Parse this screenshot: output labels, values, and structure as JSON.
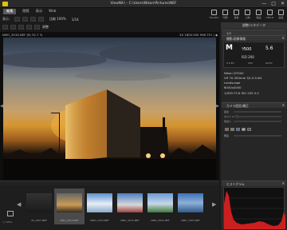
{
  "window": {
    "title": "ViewNX-i - C:\\Users\\Nikon\\Pictures\\NEF",
    "minimize": "—",
    "maximize": "□",
    "close": "✕"
  },
  "menu": {
    "items": [
      "編集",
      "閲覧",
      "表示",
      "Web"
    ]
  },
  "top_icons": [
    {
      "icon": "camera-icon",
      "label": "Transfer"
    },
    {
      "icon": "print-icon",
      "label": "印刷"
    },
    {
      "icon": "mail-icon",
      "label": "送信"
    },
    {
      "icon": "upload-icon",
      "label": "上映"
    },
    {
      "icon": "movie-icon",
      "label": "動画"
    },
    {
      "icon": "capture-icon",
      "label": "CNX-D"
    },
    {
      "icon": "panel-icon",
      "label": "画質"
    }
  ],
  "toolbar": {
    "mode_label": "表示：",
    "zoom_label": "比較 100%",
    "nav_counter": "1/14",
    "tool_label": "調整"
  },
  "viewer": {
    "filename": "NMO_3016.NEF  (8) 52.7 %",
    "meta_right": "5X  1800.500  996.751  |  ◆"
  },
  "filmstrip": {
    "thumbs": [
      {
        "caption": "22_1057.NEF",
        "selected": false
      },
      {
        "caption": "NMO_3016.NEF",
        "selected": true
      },
      {
        "caption": "NMO_1220.NEF",
        "selected": false
      },
      {
        "caption": "NMO_3270.NEF",
        "selected": false
      },
      {
        "caption": "NMO_2932.NEF",
        "selected": false
      },
      {
        "caption": "NMO_7003.NEF",
        "selected": false
      }
    ],
    "zoom_text": "□ 100%"
  },
  "panel": {
    "tab_label": "調整/メタデータ",
    "nav_counter": "1/1",
    "section_camera": "撮影/画像情報",
    "camera": {
      "mode": "M",
      "shutter": "¹⁄500",
      "fnumber": "5.6",
      "iso": "ISO 200",
      "exposure_comp": "0.0 EV",
      "focal": "250",
      "wb": "AUTO"
    },
    "camera_lines": [
      "Nikon D7000",
      "VR 70-300mm f/4.5-5.6G",
      "Landscape",
      "6000x4000"
    ],
    "settings_line": "1/500 F5.6 ISO 200 0.0",
    "section_adjust": "カメラ設定/補正",
    "adjust_labels": [
      "露出",
      "ホワイトバランス",
      "色合い",
      "輝度"
    ],
    "section_histogram": "ヒストグラム"
  },
  "colors": {
    "accent": "#e3c200",
    "histogram_red": "#e02020",
    "panel_bg": "#262626"
  }
}
